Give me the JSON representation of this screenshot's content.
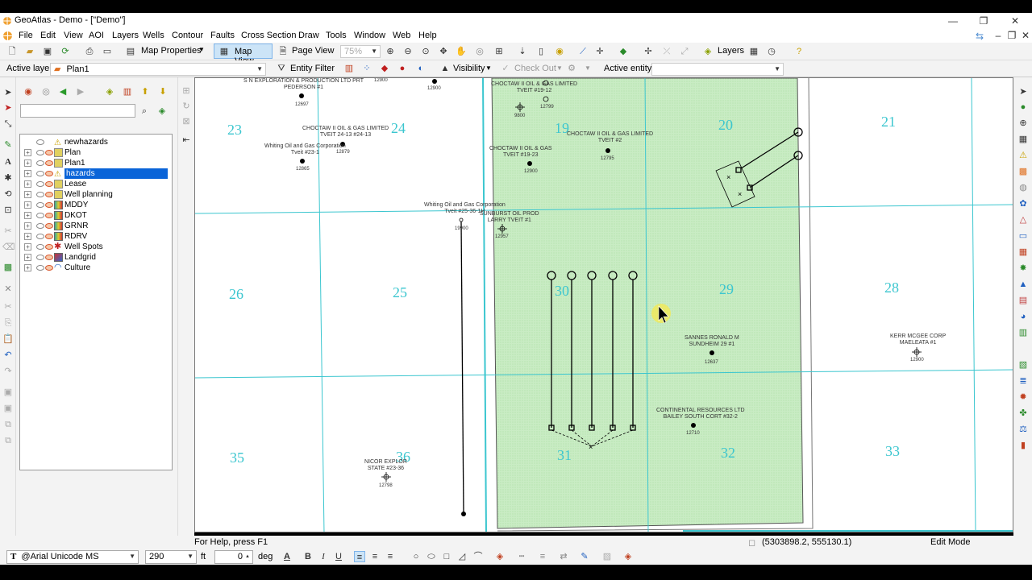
{
  "window": {
    "title": "GeoAtlas - Demo - [\"Demo\"]"
  },
  "menu": [
    "File",
    "Edit",
    "View",
    "AOI",
    "Layers",
    "Wells",
    "Contour",
    "Faults",
    "Cross Section",
    "Draw",
    "Tools",
    "Window",
    "Web",
    "Help"
  ],
  "toolbar1": {
    "map_properties": "Map Properties",
    "map_view": "Map View",
    "page_view": "Page View",
    "zoom": "75%",
    "layers": "Layers"
  },
  "toolbar2": {
    "active_layer_label": "Active layer",
    "active_layer_value": "Plan1",
    "entity_filter": "Entity Filter",
    "visibility": "Visibility",
    "check_out": "Check Out",
    "active_entity_label": "Active entity",
    "active_entity_value": ""
  },
  "layers": [
    {
      "name": "newhazards",
      "selected": false
    },
    {
      "name": "Plan",
      "selected": false
    },
    {
      "name": "Plan1",
      "selected": false
    },
    {
      "name": "hazards",
      "selected": true
    },
    {
      "name": "Lease",
      "selected": false
    },
    {
      "name": "Well planning",
      "selected": false
    },
    {
      "name": "MDDY",
      "selected": false
    },
    {
      "name": "DKOT",
      "selected": false
    },
    {
      "name": "GRNR",
      "selected": false
    },
    {
      "name": "RDRV",
      "selected": false
    },
    {
      "name": "Well Spots",
      "selected": false
    },
    {
      "name": "Landgrid",
      "selected": false
    },
    {
      "name": "Culture",
      "selected": false
    }
  ],
  "map": {
    "sections": [
      "23",
      "24",
      "19",
      "20",
      "21",
      "26",
      "25",
      "30",
      "29",
      "28",
      "35",
      "36",
      "31",
      "32",
      "33"
    ],
    "wells": [
      {
        "label": "S N EXPLORATION & PRODUCTION LTD PRT\nPEDERSON #1",
        "num": "12697"
      },
      {
        "label": "",
        "num": "12900"
      },
      {
        "label": "",
        "num": "12900"
      },
      {
        "label": "CHOCTAW II OIL & GAS LIMITED\nTVEIT 24-13 #24-13",
        "num": "12879"
      },
      {
        "label": "Whiting Oil and Gas Corporation\nTveit #23-1",
        "num": "12865"
      },
      {
        "label": "CHOCTAW II OIL & GAS LIMITED\nTVEIT #19-12",
        "num": "12799"
      },
      {
        "label": "",
        "num": "9800"
      },
      {
        "label": "CHOCTAW II OIL & GAS LIMITED\nTVEIT #2",
        "num": "12795"
      },
      {
        "label": "CHOCTAW II OIL & GAS\nTVEIT #19-23",
        "num": "12900"
      },
      {
        "label": "Whiting Oil and Gas Corporation\nTveit #25-36-1H",
        "num": "19900"
      },
      {
        "label": "SUNBURST OIL PROD\nLARRY TVEIT #1",
        "num": "12957"
      },
      {
        "label": "SANNES RONALD M\nSUNDHEIM 29 #1",
        "num": "12637"
      },
      {
        "label": "KERR MCGEE CORP\nMAELEATA #1",
        "num": "12900"
      },
      {
        "label": "CONTINENTAL RESOURCES LTD\nBAILEY SOUTH CORT #32-2",
        "num": "12710"
      },
      {
        "label": "NICOR EXPLOR\nSTATE #23-36",
        "num": "12798"
      }
    ]
  },
  "status": {
    "help": "For Help, press F1",
    "coords": "(5303898.2, 555130.1)",
    "mode": "Edit Mode"
  },
  "format": {
    "font": "@Arial Unicode MS",
    "size": "290",
    "unit": "ft",
    "angle": "0",
    "angle_unit": "deg"
  },
  "colors": {
    "selection": "#0a64d8",
    "grid": "#3bc6cf",
    "lease_fill": "#c9ecc4"
  }
}
